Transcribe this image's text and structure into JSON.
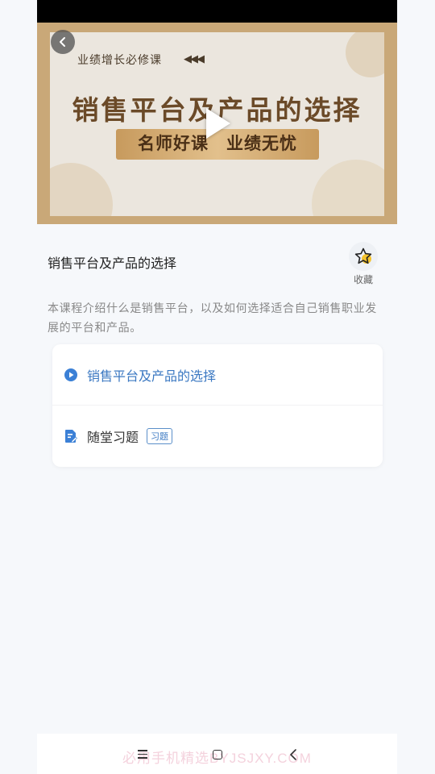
{
  "video": {
    "subtitle": "业绩增长必修课",
    "arrows": "◀◀◀",
    "title": "销售平台及产品的选择",
    "tagline": "名师好课　业绩无忧"
  },
  "course": {
    "title": "销售平台及产品的选择",
    "favorite_label": "收藏",
    "description": "本课程介绍什么是销售平台，以及如何选择适合自己销售职业发展的平台和产品。"
  },
  "lessons": [
    {
      "label": "销售平台及产品的选择",
      "icon": "play-circle-icon"
    },
    {
      "label": "随堂习题",
      "icon": "document-edit-icon",
      "badge": "习题"
    }
  ],
  "watermark": "必用手机精选BYJSJXY.COM",
  "colors": {
    "accent": "#3b78c2",
    "video_frame": "#c9a878",
    "star": "#f5c32c"
  }
}
